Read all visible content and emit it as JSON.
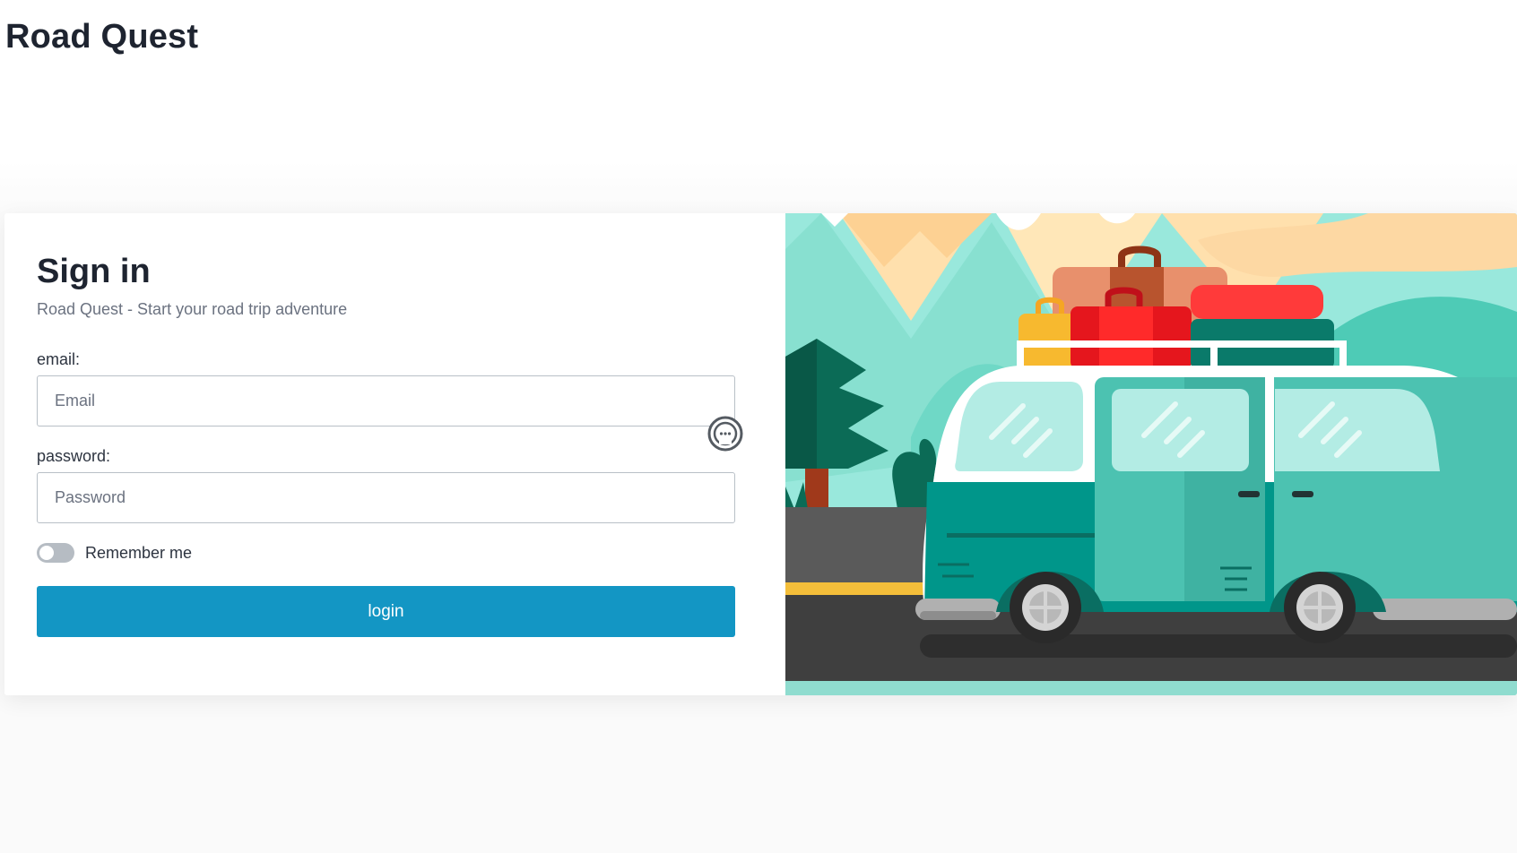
{
  "header": {
    "app_title": "Road Quest"
  },
  "signin": {
    "title": "Sign in",
    "subtitle": "Road Quest - Start your road trip adventure",
    "email_label": "email:",
    "email_placeholder": "Email",
    "email_value": "",
    "password_label": "password:",
    "password_placeholder": "Password",
    "password_value": "",
    "remember_label": "Remember me",
    "remember_checked": false,
    "login_label": "login"
  },
  "illustration": {
    "description_icon": "van-with-luggage-illustration"
  },
  "colors": {
    "accent": "#1396c4",
    "van_teal": "#00968a",
    "road": "#3f3f3f"
  }
}
